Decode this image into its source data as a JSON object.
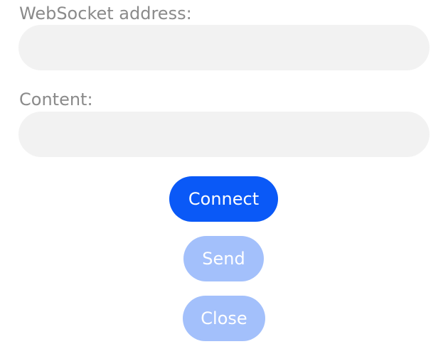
{
  "form": {
    "address_label": "WebSocket address:",
    "address_value": "",
    "content_label": "Content:",
    "content_value": ""
  },
  "actions": {
    "connect_label": "Connect",
    "send_label": "Send",
    "close_label": "Close",
    "connect_enabled": true,
    "send_enabled": false,
    "close_enabled": false
  },
  "colors": {
    "primary": "#0a59f7",
    "disabled": "#a3c0fb",
    "field_bg": "#f2f2f2",
    "label_text": "#8a8a8a"
  }
}
